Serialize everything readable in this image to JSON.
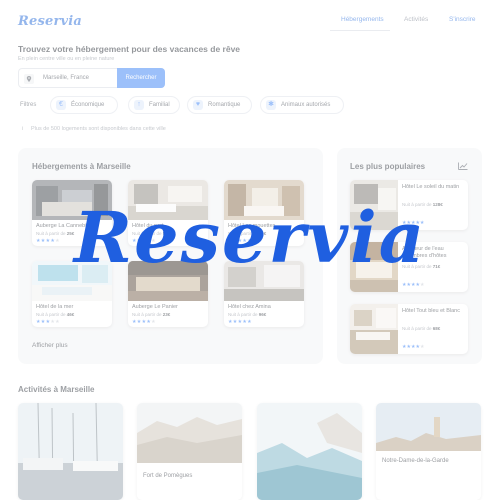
{
  "header": {
    "logo": "Reservia",
    "nav": [
      {
        "label": "Hébergements",
        "active": true
      },
      {
        "label": "Activités",
        "active": false
      },
      {
        "label": "S'inscrire",
        "active": false
      }
    ]
  },
  "hero": {
    "title": "Trouvez votre hébergement pour des vacances de rêve",
    "subtitle": "En plein centre ville ou en pleine nature"
  },
  "search": {
    "value": "Marseille, France",
    "button_label": "Rechercher"
  },
  "filters": {
    "label": "Filtres",
    "items": [
      {
        "label": "Économique",
        "icon": "money-icon"
      },
      {
        "label": "Familial",
        "icon": "child-icon"
      },
      {
        "label": "Romantique",
        "icon": "heart-icon"
      },
      {
        "label": "Animaux autorisés",
        "icon": "paw-icon"
      }
    ]
  },
  "info": {
    "text": "Plus de 500 logements sont disponibles dans cette ville"
  },
  "accommodations": {
    "title": "Hébergements à Marseille",
    "price_prefix": "Nuit à partir de",
    "items": [
      {
        "name": "Auberge La Cannebière",
        "price": "25€",
        "rating": 4
      },
      {
        "name": "Hôtel du port",
        "price": "52€",
        "rating": 4
      },
      {
        "name": "Hôtel Les mouettes",
        "price": "76€",
        "rating": 5
      },
      {
        "name": "Hôtel de la mer",
        "price": "46€",
        "rating": 3
      },
      {
        "name": "Auberge Le Panier",
        "price": "23€",
        "rating": 4
      },
      {
        "name": "Hôtel chez Amina",
        "price": "96€",
        "rating": 5
      }
    ],
    "see_more": "Afficher plus"
  },
  "popular": {
    "title": "Les plus populaires",
    "price_prefix": "Nuit à partir de",
    "items": [
      {
        "name": "Hôtel Le soleil du matin",
        "price": "128€",
        "rating": 5
      },
      {
        "name": "Au cœur de l'eau Chambres d'hôtes",
        "price": "71€",
        "rating": 4
      },
      {
        "name": "Hôtel Tout bleu et Blanc",
        "price": "68€",
        "rating": 4
      }
    ]
  },
  "activities": {
    "title": "Activités à Marseille",
    "items": [
      {
        "label": ""
      },
      {
        "label": "Fort de Pomègues"
      },
      {
        "label": ""
      },
      {
        "label": "Notre-Dame-de-la-Garde"
      }
    ]
  },
  "overlay": {
    "watermark": "Reservia"
  },
  "colors": {
    "accent": "#3b82f6",
    "brand": "#2b6fdb",
    "panel": "#f3f4f6"
  }
}
